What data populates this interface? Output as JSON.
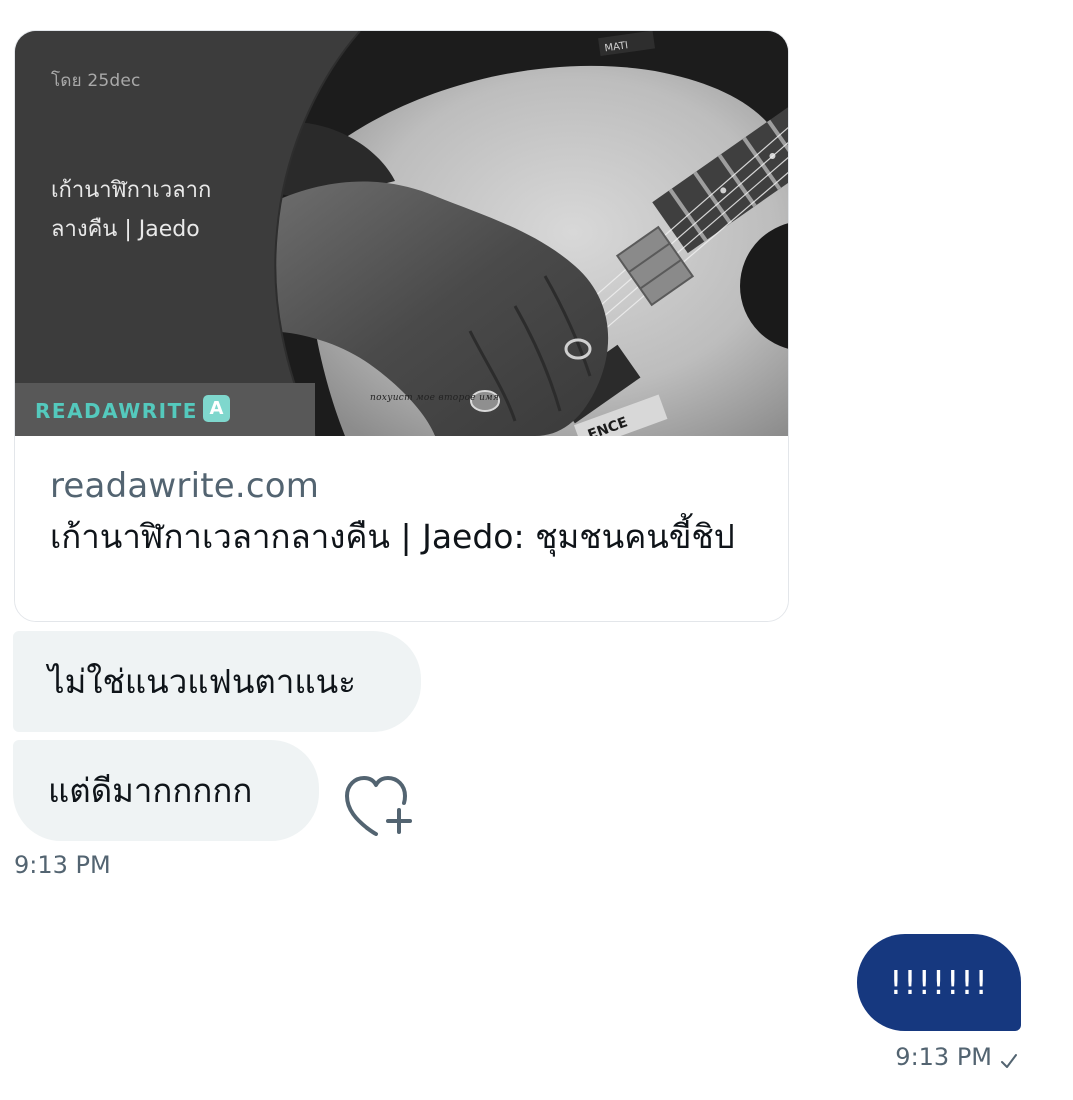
{
  "link_card": {
    "image": {
      "author_line": "โดย  25dec",
      "title_overlay": "เก้านาฬิกาเวลากลางคืน | Jaedo",
      "brand": "READAWRITE",
      "brand_badge": "A",
      "watermark": "похуист мое второе имя",
      "icon": "guitar-photo"
    },
    "domain": "readawrite.com",
    "title": "เก้านาฬิกาเวลากลางคืน | Jaedo: ชุมชนคนขี้ชิป"
  },
  "received_messages": [
    {
      "text": "ไม่ใช่แนวแฟนตาแนะ"
    },
    {
      "text": "แต่ดีมากกกกก"
    }
  ],
  "received_time": "9:13 PM",
  "reaction_icon": "heart-add-icon",
  "sent_message": {
    "text": "!!!!!!!"
  },
  "sent_time": "9:13 PM",
  "sent_status_icon": "check-icon",
  "colors": {
    "sent_bubble": "#16387f",
    "received_bubble": "#eff3f4",
    "meta_text": "#536471",
    "brand": "#54c9bd"
  }
}
